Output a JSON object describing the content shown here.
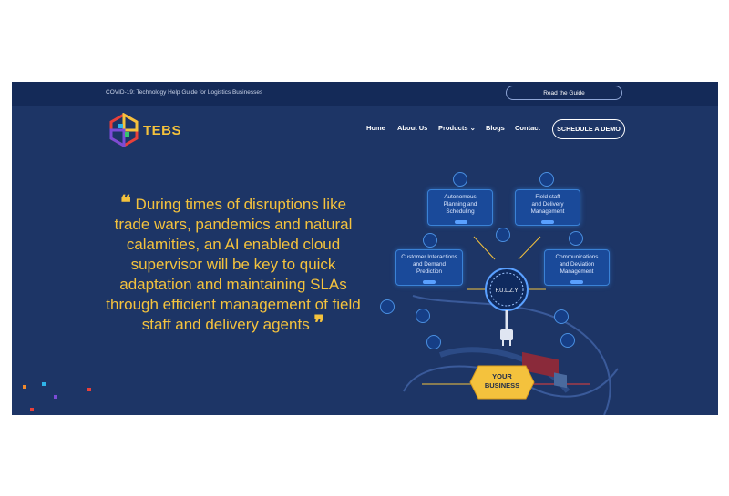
{
  "topbar": {
    "announcement": "COVID-19: Technology Help Guide for Logistics Businesses",
    "guide_button": "Read the Guide"
  },
  "header": {
    "brand": "TEBS",
    "nav": [
      "Home",
      "About Us",
      "Products",
      "Blogs",
      "Contact"
    ],
    "products_chevron": "⌄",
    "demo_button": "SCHEDULE A DEMO"
  },
  "hero": {
    "quote_open": "❝",
    "quote_lines": [
      "During times of disruptions like",
      "trade wars, pandemics and natural",
      "calamities, an AI enabled cloud",
      "supervisor will be key to quick",
      "adaptation and maintaining SLAs",
      "through efficient management of field",
      "staff and delivery agents"
    ],
    "quote_close": "❞"
  },
  "diagram": {
    "hub": "F.U.L.Z.Y",
    "boxes": [
      {
        "lines": [
          "Autonomous",
          "Planning and",
          "Scheduling"
        ]
      },
      {
        "lines": [
          "Field staff",
          "and Delivery",
          "Management"
        ]
      },
      {
        "lines": [
          "Customer Interactions",
          "and Demand",
          "Prediction"
        ]
      },
      {
        "lines": [
          "Communications",
          "and Deviation",
          "Management"
        ]
      }
    ],
    "business": [
      "YOUR",
      "BUSINESS"
    ]
  },
  "colors": {
    "background": "#1d3566",
    "topbar": "#142a58",
    "accent": "#f4c23d",
    "box": "#1a4a9a",
    "glow": "#3b82d6"
  }
}
